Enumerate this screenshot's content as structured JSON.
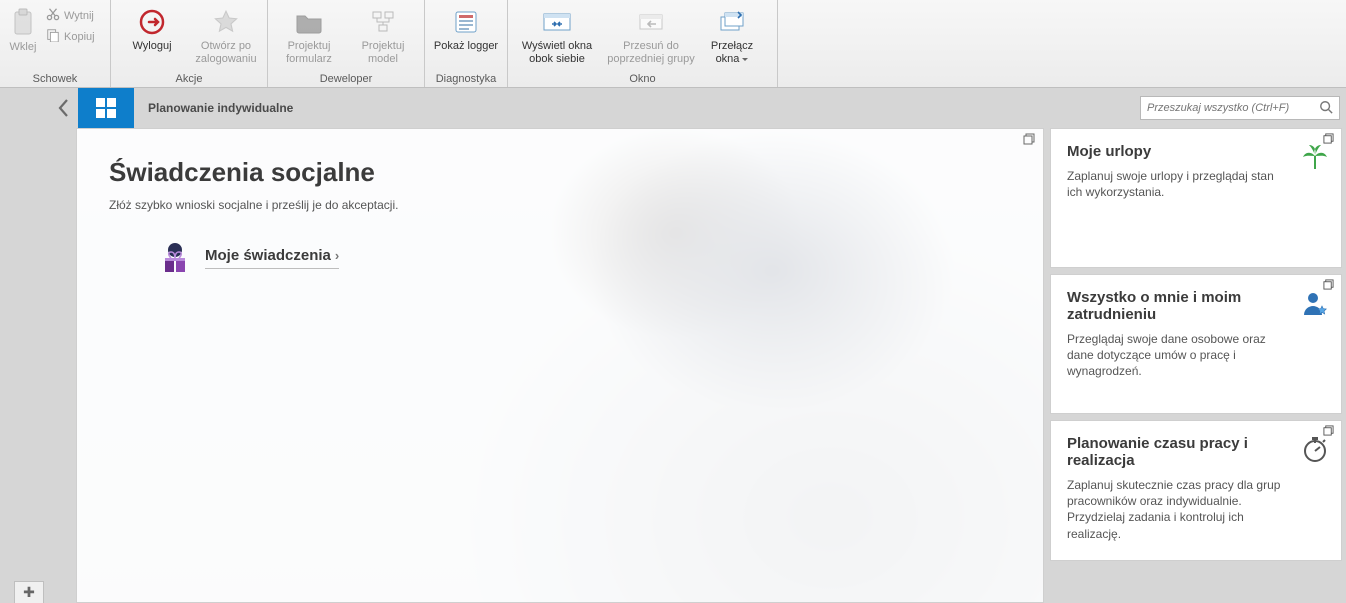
{
  "ribbon": {
    "clipboard": {
      "paste": "Wklej",
      "cut": "Wytnij",
      "copy": "Kopiuj",
      "group": "Schowek"
    },
    "actions": {
      "logout": "Wyloguj",
      "open_after_login": "Otwórz po zalogowaniu",
      "group": "Akcje"
    },
    "developer": {
      "design_form": "Projektuj formularz",
      "design_model": "Projektuj model",
      "group": "Deweloper"
    },
    "diagnostics": {
      "show_logger": "Pokaż logger",
      "group": "Diagnostyka"
    },
    "window": {
      "side_by_side": "Wyświetl okna obok siebie",
      "move_prev": "Przesuń do poprzedniej grupy",
      "switch_windows": "Przełącz okna",
      "group": "Okno"
    }
  },
  "header": {
    "breadcrumb": "Planowanie indywidualne",
    "search_placeholder": "Przeszukaj wszystko (Ctrl+F)"
  },
  "main": {
    "title": "Świadczenia socjalne",
    "subtitle": "Złóż szybko wnioski socjalne i prześlij je do akceptacji.",
    "action_label": "Moje świadczenia"
  },
  "side": {
    "vacation": {
      "title": "Moje urlopy",
      "text": "Zaplanuj swoje urlopy i przeglądaj stan ich wykorzystania."
    },
    "aboutme": {
      "title": "Wszystko o mnie i moim zatrudnieniu",
      "text": "Przeglądaj swoje dane osobowe oraz dane dotyczące umów o pracę i wynagrodzeń."
    },
    "planning": {
      "title": "Planowanie czasu pracy i realizacja",
      "text": "Zaplanuj skutecznie czas pracy dla grup pracowników oraz indywidualnie. Przydzielaj zadania i kontroluj ich realizację."
    }
  }
}
